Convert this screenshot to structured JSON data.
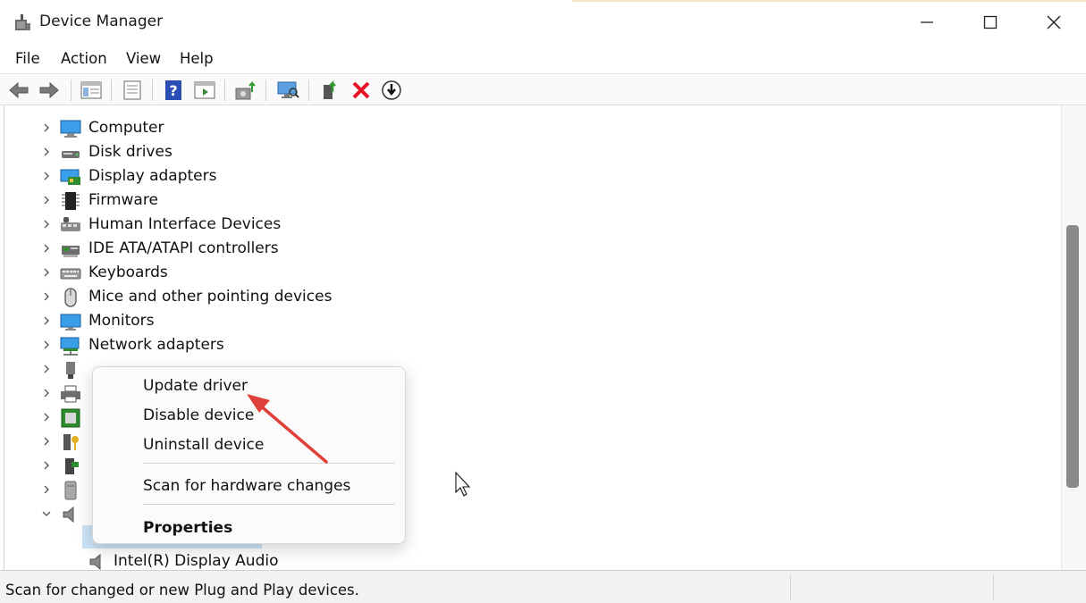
{
  "window": {
    "title": "Device Manager",
    "menus": [
      "File",
      "Action",
      "View",
      "Help"
    ]
  },
  "toolbar": {
    "buttons": [
      "back-icon",
      "forward-icon",
      "show-hide-console-tree-icon",
      "properties-icon",
      "help-icon",
      "action-pane-icon",
      "update-driver-icon",
      "scan-hardware-icon",
      "enable-device-icon",
      "uninstall-icon",
      "disable-icon"
    ]
  },
  "tree": {
    "categories": [
      {
        "label": "Computer",
        "icon": "computer-icon"
      },
      {
        "label": "Disk drives",
        "icon": "disk-drive-icon"
      },
      {
        "label": "Display adapters",
        "icon": "display-adapter-icon"
      },
      {
        "label": "Firmware",
        "icon": "firmware-icon"
      },
      {
        "label": "Human Interface Devices",
        "icon": "hid-icon"
      },
      {
        "label": "IDE ATA/ATAPI controllers",
        "icon": "ide-controller-icon"
      },
      {
        "label": "Keyboards",
        "icon": "keyboard-icon"
      },
      {
        "label": "Mice and other pointing devices",
        "icon": "mouse-icon"
      },
      {
        "label": "Monitors",
        "icon": "monitor-icon"
      },
      {
        "label": "Network adapters",
        "icon": "network-adapter-icon"
      }
    ],
    "child_item": "Intel(R) Display Audio"
  },
  "context_menu": {
    "items": [
      "Update driver",
      "Disable device",
      "Uninstall device",
      "Scan for hardware changes",
      "Properties"
    ]
  },
  "status": {
    "text": "Scan for changed or new Plug and Play devices."
  },
  "colors": {
    "selection": "#cce4f7",
    "annotation_arrow": "#e0403a",
    "uninstall_red": "#e81123",
    "help_blue": "#2b4eb5"
  }
}
